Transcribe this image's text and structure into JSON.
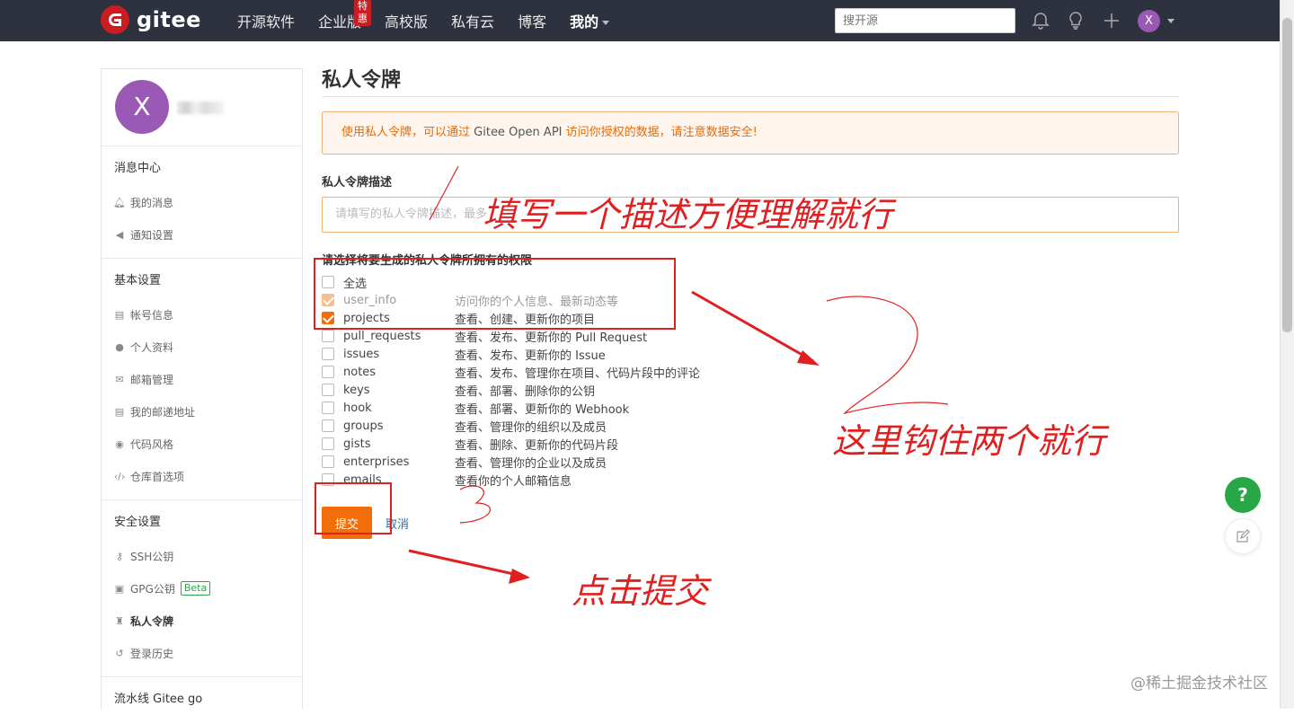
{
  "topbar": {
    "logo_text": "gitee",
    "nav": [
      {
        "label": "开源软件"
      },
      {
        "label": "企业版",
        "badge": "特惠"
      },
      {
        "label": "高校版"
      },
      {
        "label": "私有云"
      },
      {
        "label": "博客"
      },
      {
        "label": "我的"
      }
    ],
    "search_placeholder": "搜开源",
    "avatar_letter": "X"
  },
  "sidebar": {
    "avatar_letter": "X",
    "sections": [
      {
        "title": "消息中心",
        "items": [
          {
            "label": "我的消息",
            "icon": "bell-icon"
          },
          {
            "label": "通知设置",
            "icon": "volume-icon"
          }
        ]
      },
      {
        "title": "基本设置",
        "items": [
          {
            "label": "帐号信息",
            "icon": "id-card-icon"
          },
          {
            "label": "个人资料",
            "icon": "user-icon"
          },
          {
            "label": "邮箱管理",
            "icon": "mail-icon"
          },
          {
            "label": "我的邮递地址",
            "icon": "address-card-icon"
          },
          {
            "label": "代码风格",
            "icon": "palette-icon"
          },
          {
            "label": "仓库首选项",
            "icon": "code-icon"
          }
        ]
      },
      {
        "title": "安全设置",
        "items": [
          {
            "label": "SSH公钥",
            "icon": "key-icon"
          },
          {
            "label": "GPG公钥",
            "icon": "lock-icon",
            "badge": "Beta"
          },
          {
            "label": "私人令牌",
            "icon": "token-icon",
            "active": true
          },
          {
            "label": "登录历史",
            "icon": "history-icon"
          }
        ]
      },
      {
        "title": "流水线 Gitee go",
        "items": []
      }
    ]
  },
  "main": {
    "title": "私人令牌",
    "notice_prefix": "使用私人令牌，可以通过",
    "notice_api": "Gitee Open API",
    "notice_suffix": "访问你授权的数据，请注意数据安全!",
    "desc_label": "私人令牌描述",
    "desc_placeholder": "请填写的私人令牌描述，最多",
    "perm_label": "请选择将要生成的私人令牌所拥有的权限",
    "select_all": "全选",
    "permissions": [
      {
        "name": "user_info",
        "desc": "访问你的个人信息、最新动态等",
        "checked": true,
        "disabled": true
      },
      {
        "name": "projects",
        "desc": "查看、创建、更新你的项目",
        "checked": true
      },
      {
        "name": "pull_requests",
        "desc": "查看、发布、更新你的 Pull Request",
        "checked": false
      },
      {
        "name": "issues",
        "desc": "查看、发布、更新你的 Issue",
        "checked": false
      },
      {
        "name": "notes",
        "desc": "查看、发布、管理你在项目、代码片段中的评论",
        "checked": false
      },
      {
        "name": "keys",
        "desc": "查看、部署、删除你的公钥",
        "checked": false
      },
      {
        "name": "hook",
        "desc": "查看、部署、更新你的 Webhook",
        "checked": false
      },
      {
        "name": "groups",
        "desc": "查看、管理你的组织以及成员",
        "checked": false
      },
      {
        "name": "gists",
        "desc": "查看、删除、更新你的代码片段",
        "checked": false
      },
      {
        "name": "enterprises",
        "desc": "查看、管理你的企业以及成员",
        "checked": false
      },
      {
        "name": "emails",
        "desc": "查看你的个人邮箱信息",
        "checked": false
      }
    ],
    "submit_label": "提交",
    "cancel_label": "取消"
  },
  "float": {
    "help": "?"
  },
  "annotations": {
    "step1": "填写一个描述方便理解就行",
    "step2": "这里钩住两个就行",
    "step3": "点击提交"
  },
  "watermark": "@稀土掘金技术社区"
}
